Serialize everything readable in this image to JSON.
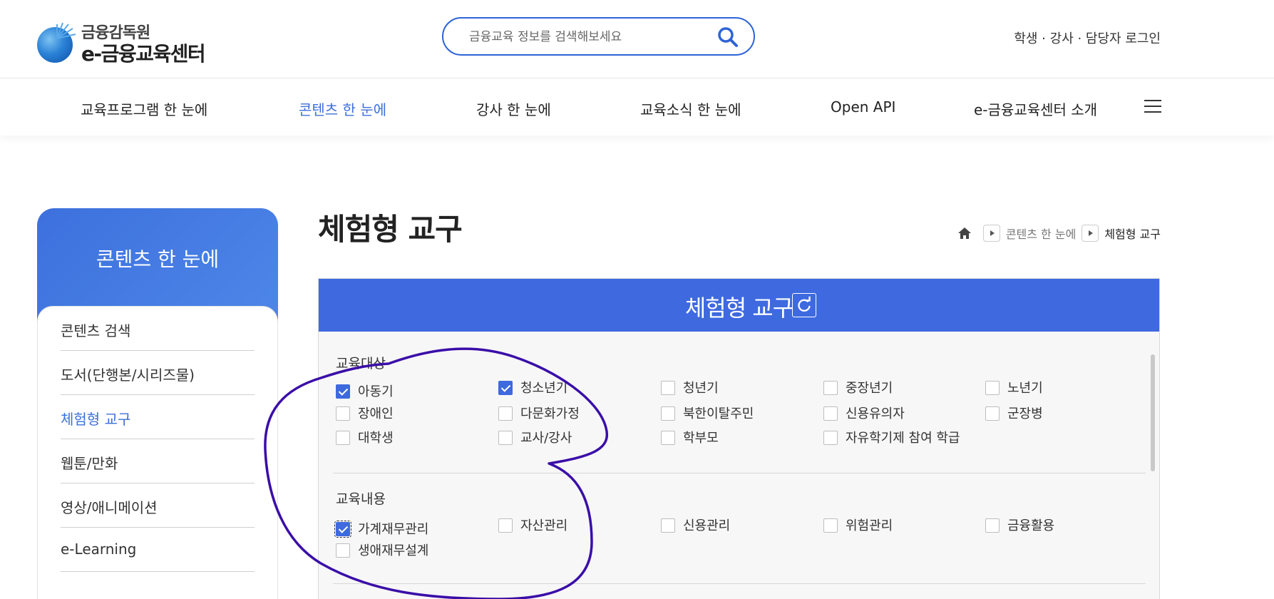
{
  "header": {
    "logo_top": "금융감독원",
    "logo_bottom": "e-금융교육센터",
    "search_placeholder": "금융교육 정보를 검색해보세요",
    "login_text": "학생 · 강사 · 담당자 로그인"
  },
  "nav": {
    "items": [
      {
        "label": "교육프로그램 한 눈에"
      },
      {
        "label": "콘텐츠 한 눈에"
      },
      {
        "label": "강사 한 눈에"
      },
      {
        "label": "교육소식 한 눈에"
      },
      {
        "label": "Open API"
      },
      {
        "label": "e-금융교육센터 소개"
      }
    ],
    "active": "콘텐츠 한 눈에"
  },
  "sidebar": {
    "title": "콘텐츠 한 눈에",
    "items": [
      {
        "label": "콘텐츠 검색"
      },
      {
        "label": "도서(단행본/시리즈물)"
      },
      {
        "label": "체험형 교구"
      },
      {
        "label": "웹툰/만화"
      },
      {
        "label": "영상/애니메이션"
      },
      {
        "label": "e-Learning"
      }
    ],
    "active": "체험형 교구"
  },
  "main": {
    "page_title": "체험형 교구",
    "breadcrumb": [
      "콘텐츠 한 눈에",
      "체험형 교구"
    ]
  },
  "panel": {
    "title": "체험형 교구",
    "groups": [
      {
        "label": "교육대상",
        "options": [
          {
            "label": "아동기",
            "checked": true
          },
          {
            "label": "청소년기",
            "checked": true
          },
          {
            "label": "청년기",
            "checked": false
          },
          {
            "label": "중장년기",
            "checked": false
          },
          {
            "label": "노년기",
            "checked": false
          },
          {
            "label": "장애인",
            "checked": false
          },
          {
            "label": "다문화가정",
            "checked": false
          },
          {
            "label": "북한이탈주민",
            "checked": false
          },
          {
            "label": "신용유의자",
            "checked": false
          },
          {
            "label": "군장병",
            "checked": false
          },
          {
            "label": "대학생",
            "checked": false
          },
          {
            "label": "교사/강사",
            "checked": false
          },
          {
            "label": "학부모",
            "checked": false
          },
          {
            "label": "자유학기제 참여 학급",
            "checked": false
          }
        ]
      },
      {
        "label": "교육내용",
        "options": [
          {
            "label": "가계재무관리",
            "checked": true
          },
          {
            "label": "자산관리",
            "checked": false
          },
          {
            "label": "신용관리",
            "checked": false
          },
          {
            "label": "위험관리",
            "checked": false
          },
          {
            "label": "금융활용",
            "checked": false
          },
          {
            "label": "생애재무설계",
            "checked": false
          }
        ]
      }
    ]
  },
  "colors": {
    "accent": "#3e69df",
    "active_text": "#3d6fd9",
    "annotation_ink": "#3a0ea8"
  }
}
